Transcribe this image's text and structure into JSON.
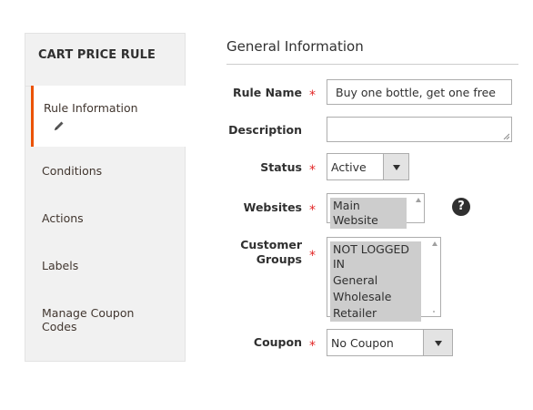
{
  "sidebar": {
    "title": "CART PRICE RULE",
    "items": [
      {
        "label": "Rule Information",
        "active": true
      },
      {
        "label": "Conditions"
      },
      {
        "label": "Actions"
      },
      {
        "label": "Labels"
      },
      {
        "label": "Manage Coupon Codes"
      }
    ]
  },
  "section": {
    "title": "General Information"
  },
  "form": {
    "rule_name": {
      "label": "Rule Name",
      "value": "Buy one bottle, get one free",
      "required": true
    },
    "description": {
      "label": "Description",
      "value": ""
    },
    "status": {
      "label": "Status",
      "value": "Active",
      "required": true
    },
    "websites": {
      "label": "Websites",
      "options": [
        "Main Website"
      ],
      "required": true
    },
    "customer_groups": {
      "label_line1": "Customer",
      "label_line2": "Groups",
      "options": [
        "NOT LOGGED IN",
        "General",
        "Wholesale",
        "Retailer"
      ],
      "required": true
    },
    "coupon": {
      "label": "Coupon",
      "value": "No Coupon",
      "required": true
    }
  },
  "required_mark": "*",
  "help_glyph": "?",
  "colors": {
    "accent": "#eb5202",
    "required": "#e22626",
    "sidebar_bg": "#f1f1f1"
  }
}
